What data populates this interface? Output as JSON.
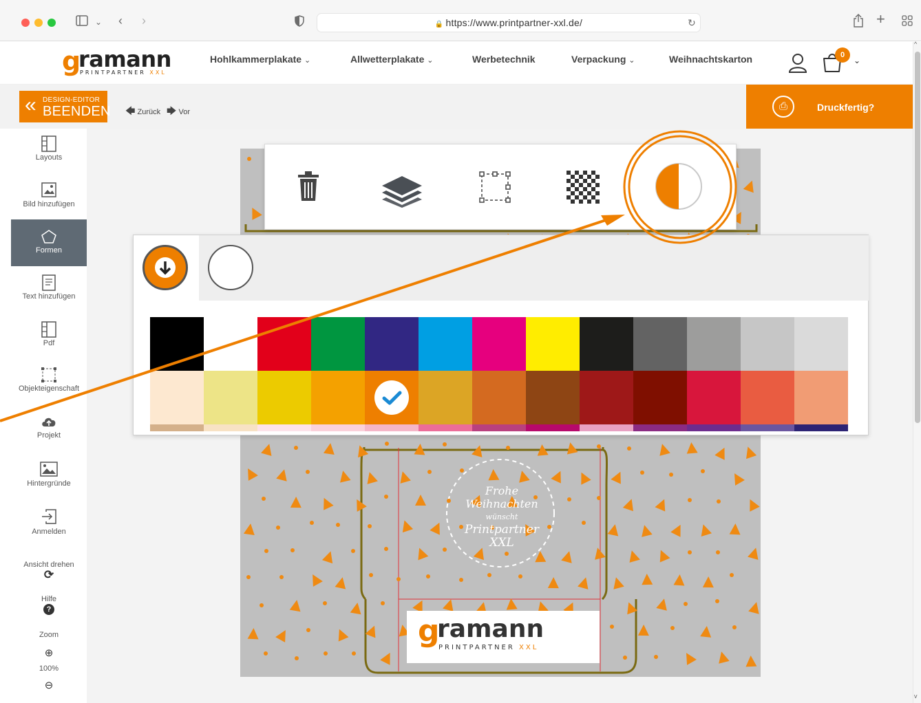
{
  "browser": {
    "url": "https://www.printpartner-xxl.de/"
  },
  "logo": {
    "brand_first": "g",
    "brand_rest": "ramann",
    "sub_main": "PRINTPARTNER",
    "sub_accent": "XXL"
  },
  "nav": {
    "items": [
      {
        "label": "Hohlkammerplakate",
        "dropdown": true
      },
      {
        "label": "Allwetterplakate",
        "dropdown": true
      },
      {
        "label": "Werbetechnik",
        "dropdown": false
      },
      {
        "label": "Verpackung",
        "dropdown": true
      },
      {
        "label": "Weihnachtskarton",
        "dropdown": false
      }
    ],
    "cart_count": "0"
  },
  "editor": {
    "exit_line1": "DESIGN-EDITOR",
    "exit_line2": "BEENDEN",
    "undo_label": "Zurück",
    "redo_label": "Vor",
    "print_ready_label": "Druckfertig?"
  },
  "sidebar": {
    "items": [
      {
        "label": "Layouts",
        "icon": "layout-icon"
      },
      {
        "label": "Bild hinzufügen",
        "icon": "add-image-icon"
      },
      {
        "label": "Formen",
        "icon": "pentagon-icon",
        "active": true
      },
      {
        "label": "Text hinzufügen",
        "icon": "text-icon"
      },
      {
        "label": "Pdf",
        "icon": "pdf-icon"
      },
      {
        "label": "Objekteigenschaft",
        "icon": "object-properties-icon"
      },
      {
        "label": "Projekt",
        "icon": "cloud-icon"
      },
      {
        "label": "Hintergründe",
        "icon": "background-icon"
      },
      {
        "label": "Anmelden",
        "icon": "login-icon"
      }
    ],
    "rotate_label": "Ansicht drehen",
    "help_label": "Hilfe",
    "zoom_label": "Zoom",
    "zoom_value": "100%"
  },
  "artboard": {
    "greeting_line1": "Frohe",
    "greeting_line2": "Weihnachten",
    "greeting_line3": "wünscht",
    "greeting_line4": "Printpartner",
    "greeting_line5": "XXL",
    "logo_first": "g",
    "logo_rest": "ramann",
    "logo_sub_main": "PRINTPARTNER",
    "logo_sub_accent": "XXL"
  },
  "toolbar": {
    "tools": [
      "trash-icon",
      "layers-icon",
      "resize-icon",
      "transparency-icon",
      "fill-color-icon"
    ],
    "highlighted": "fill-color-icon"
  },
  "color_panel": {
    "tabs": [
      "fill-mode-tab",
      "no-fill-tab"
    ],
    "row1": [
      "#000000",
      "#ffffff",
      "#e2001a",
      "#009640",
      "#312783",
      "#009fe3",
      "#e6007e",
      "#ffed00",
      "#1d1d1b",
      "#636363",
      "#9d9d9c",
      "#c6c6c6",
      "#dadada"
    ],
    "row2": [
      "#fde8d0",
      "#ede487",
      "#eccb00",
      "#f4a100",
      "#ee7f00",
      "#dca525",
      "#d46a20",
      "#8e4514",
      "#9e1818",
      "#7f0f00",
      "#d8163c",
      "#e95c41",
      "#f19c74"
    ],
    "row3": [
      "#d4b08a",
      "#f8e2c4",
      "#fde3ea",
      "#fbd1da",
      "#f5b6c8",
      "#ec6d99",
      "#b9407f",
      "#b7096c",
      "#e8a1c3",
      "#8b2b83",
      "#6d2c8e",
      "#6b56a0",
      "#2c2374"
    ],
    "selected_index": 4,
    "accent": "#ee7f00"
  }
}
